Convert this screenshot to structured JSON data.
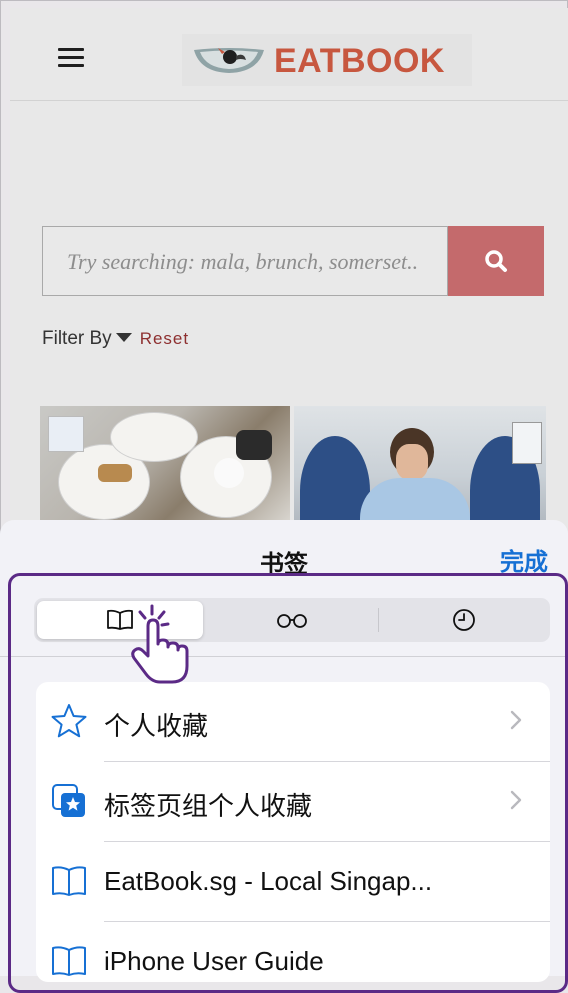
{
  "website": {
    "logo_text": "EATBOOK",
    "search": {
      "placeholder": "Try searching: mala, brunch, somerset.."
    },
    "filter": {
      "label": "Filter By",
      "reset": "Reset"
    }
  },
  "bookmarks_sheet": {
    "title": "书签",
    "done": "完成",
    "tabs": [
      {
        "name": "bookmarks",
        "icon": "book-icon",
        "selected": true
      },
      {
        "name": "reading-list",
        "icon": "glasses-icon",
        "selected": false
      },
      {
        "name": "history",
        "icon": "clock-icon",
        "selected": false
      }
    ],
    "items": [
      {
        "label": "个人收藏",
        "icon": "star-icon",
        "has_chevron": true
      },
      {
        "label": "标签页组个人收藏",
        "icon": "tab-group-star-icon",
        "has_chevron": true
      },
      {
        "label": "EatBook.sg - Local Singap...",
        "icon": "book-icon",
        "has_chevron": false
      },
      {
        "label": "iPhone User Guide",
        "icon": "book-icon",
        "has_chevron": false
      }
    ]
  },
  "colors": {
    "accent": "#1670d4",
    "highlight_border": "#5b2a86",
    "search_button": "#c46a6c",
    "logo": "#c7573f"
  }
}
